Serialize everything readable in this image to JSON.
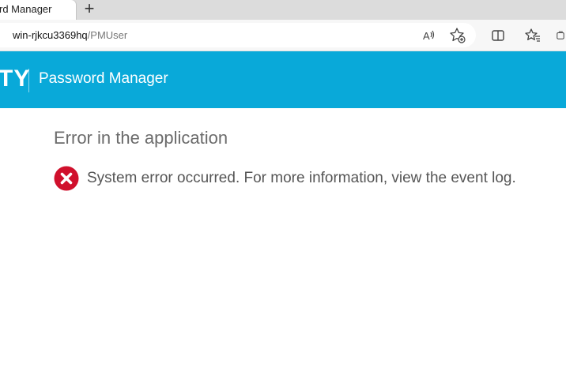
{
  "browser": {
    "tab_title": "rd Manager",
    "new_tab_symbol": "+",
    "url_host": "win-rjkcu3369hq",
    "url_path": "/PMUser",
    "toolbar_icons": [
      "read-aloud-icon",
      "add-favorite-icon",
      "split-screen-icon",
      "favorites-icon",
      "collections-icon"
    ]
  },
  "header": {
    "brand": "TY",
    "app_title": "Password Manager",
    "background_color": "#09a9d9"
  },
  "error": {
    "heading": "Error in the application",
    "message": "System error occurred. For more information, view the event log.",
    "icon": "error-x-icon",
    "icon_color": "#d0102c"
  }
}
